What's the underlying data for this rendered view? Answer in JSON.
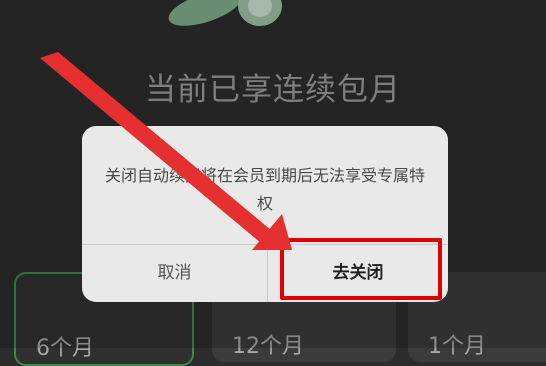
{
  "headline": "当前已享连续包月",
  "dialog": {
    "message": "关闭自动续费将在会员到期后无法享受专属特权",
    "cancel_label": "取消",
    "confirm_label": "去关闭"
  },
  "plans": [
    {
      "label": "6个月",
      "selected": true
    },
    {
      "label": "12个月",
      "selected": false
    },
    {
      "label": "1个月",
      "selected": false
    }
  ],
  "annotation": {
    "highlight_color": "#e00000",
    "arrow_color": "#e63030"
  },
  "icons": [
    "leaf-logo-icon",
    "red-arrow-icon"
  ]
}
